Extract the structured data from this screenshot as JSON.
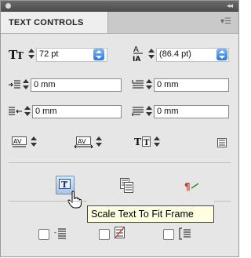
{
  "panel": {
    "tab_label": "TEXT CONTROLS",
    "collapse_glyph": "◂◂",
    "menu_glyph": "▾☰"
  },
  "font_size": {
    "value": "72 pt",
    "icon": "font-size-icon"
  },
  "leading": {
    "value": "(86.4 pt)",
    "icon": "leading-icon"
  },
  "left_indent": {
    "value": "0 mm",
    "icon": "left-indent-icon"
  },
  "first_line_indent": {
    "value": "0 mm",
    "icon": "first-line-indent-icon"
  },
  "right_indent": {
    "value": "0 mm",
    "icon": "right-indent-icon"
  },
  "last_line_indent": {
    "value": "0 mm",
    "icon": "last-line-indent-icon"
  },
  "tooltip": {
    "text": "Scale Text To Fit Frame"
  },
  "colors": {
    "accent": "#2f78d6",
    "tooltip_bg": "#ffffe1",
    "panel_bg": "#e6e6e6"
  }
}
